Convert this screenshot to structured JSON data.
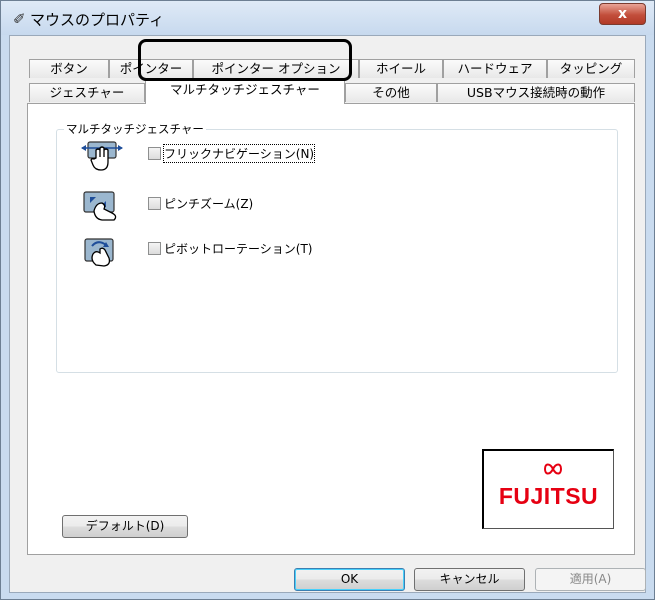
{
  "window": {
    "title": "マウスのプロパティ",
    "close_label": "x"
  },
  "tabs_row1": [
    {
      "label": "ボタン"
    },
    {
      "label": "ポインター"
    },
    {
      "label": "ポインター オプション"
    },
    {
      "label": "ホイール"
    },
    {
      "label": "ハードウェア"
    },
    {
      "label": "タッピング"
    }
  ],
  "tabs_row2": [
    {
      "label": "ジェスチャー"
    },
    {
      "label": "マルチタッチジェスチャー",
      "active": true
    },
    {
      "label": "その他"
    },
    {
      "label": "USBマウス接続時の動作"
    }
  ],
  "group": {
    "title": "マルチタッチジェスチャー",
    "options": [
      {
        "label": "フリックナビゲーション(N)",
        "checked": false,
        "icon": "flick-navigation-icon"
      },
      {
        "label": "ピンチズーム(Z)",
        "checked": false,
        "icon": "pinch-zoom-icon"
      },
      {
        "label": "ピボットローテーション(T)",
        "checked": false,
        "icon": "pivot-rotation-icon"
      }
    ]
  },
  "buttons": {
    "default": "デフォルト(D)",
    "ok": "OK",
    "cancel": "キャンセル",
    "apply": "適用(A)"
  },
  "logo": {
    "text": "FUJITSU",
    "color": "#e60012"
  }
}
